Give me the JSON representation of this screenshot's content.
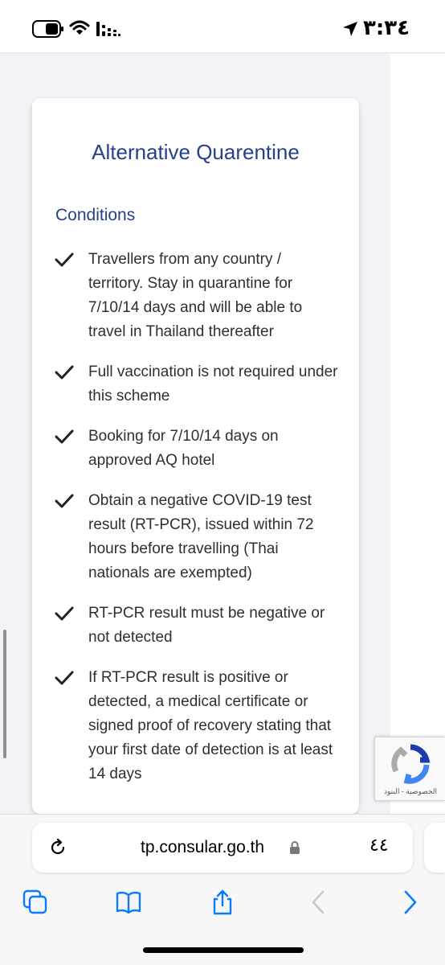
{
  "status_bar": {
    "time": "٣:٣٤",
    "icons": [
      "battery-icon",
      "wifi-icon",
      "cellular-signal-icon",
      "location-arrow-icon"
    ]
  },
  "card": {
    "title": "Alternative Quarentine",
    "conditions_heading": "Conditions",
    "conditions": [
      "Travellers from any country / territory. Stay in quarantine for 7/10/14 days and will be able to travel in Thailand thereafter",
      "Full vaccination is not required under this scheme",
      "Booking for 7/10/14 days on approved AQ hotel",
      "Obtain a negative COVID-19 test result (RT-PCR), issued within 72 hours before travelling (Thai nationals are exempted)",
      "RT-PCR result must be negative or not detected",
      "If RT-PCR result is positive or detected, a medical certificate or signed proof of recovery stating that your first date of detection is at least 14 days"
    ]
  },
  "recaptcha": {
    "links": "الخصوصية - البنود"
  },
  "browser": {
    "url": "tp.consular.go.th",
    "tab_count": "٤٤",
    "toolbar_icons": [
      "tabs-icon",
      "bookmarks-icon",
      "share-icon",
      "back-chevron-icon",
      "forward-chevron-icon"
    ]
  },
  "colors": {
    "accent": "#27408b",
    "ios_blue": "#0a7aff"
  }
}
